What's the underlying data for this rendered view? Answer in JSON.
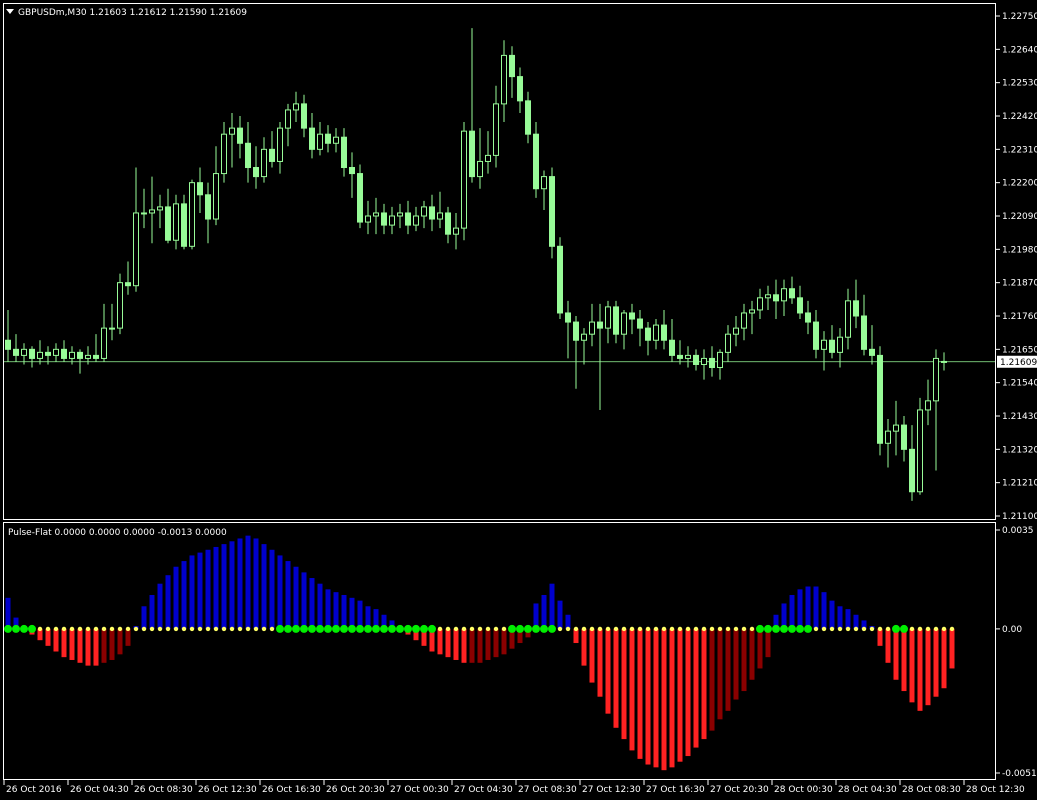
{
  "header": {
    "symbol_line": "GBPUSDm,M30  1.21603 1.21612 1.21590 1.21609"
  },
  "indicator_header": "Pulse-Flat 0.0000 0.0000 0.0000 -0.0013 0.0000",
  "colors": {
    "background": "#000000",
    "frame": "#ffffff",
    "candle": "#98fb98",
    "candle_bull_body": "#000000",
    "candle_bear_body": "#98fb98",
    "bid_line": "#98fb98",
    "hist_up": "#0000cd",
    "hist_down_bright": "#ff2222",
    "hist_down_dark": "#8b0000",
    "dot_yellow": "#ffff66",
    "dot_green": "#00ee00"
  },
  "price_axis": {
    "ticks": [
      "1.22750",
      "1.22640",
      "1.22530",
      "1.22420",
      "1.22310",
      "1.22200",
      "1.22090",
      "1.21980",
      "1.21870",
      "1.21760",
      "1.21650",
      "1.21540",
      "1.21430",
      "1.21320",
      "1.21210",
      "1.21100"
    ],
    "current_label": "1.21609",
    "current_value": 1.21609,
    "range": [
      1.211,
      1.2275
    ]
  },
  "indicator_axis": {
    "ticks": [
      "0.0035",
      "0.00",
      "-0.0051"
    ],
    "range": [
      -0.0051,
      0.0035
    ]
  },
  "time_axis": {
    "labels": [
      "26 Oct 2016",
      "26 Oct 04:30",
      "26 Oct 08:30",
      "26 Oct 12:30",
      "26 Oct 16:30",
      "26 Oct 20:30",
      "27 Oct 00:30",
      "27 Oct 04:30",
      "27 Oct 08:30",
      "27 Oct 12:30",
      "27 Oct 16:30",
      "27 Oct 20:30",
      "28 Oct 00:30",
      "28 Oct 04:30",
      "28 Oct 08:30",
      "28 Oct 12:30"
    ],
    "label_bar_index": [
      0,
      8,
      16,
      24,
      32,
      40,
      48,
      56,
      64,
      72,
      80,
      88,
      96,
      104,
      112,
      120
    ]
  },
  "chart_data": [
    {
      "type": "candlestick",
      "series_ohlc": [
        [
          1.2168,
          1.2178,
          1.2161,
          1.2165
        ],
        [
          1.2165,
          1.217,
          1.2161,
          1.2163
        ],
        [
          1.2163,
          1.2167,
          1.216,
          1.2165
        ],
        [
          1.2165,
          1.2166,
          1.2159,
          1.2162
        ],
        [
          1.2162,
          1.2168,
          1.216,
          1.2164
        ],
        [
          1.2164,
          1.2166,
          1.216,
          1.2163
        ],
        [
          1.2163,
          1.2167,
          1.2161,
          1.2165
        ],
        [
          1.2165,
          1.2168,
          1.2161,
          1.2162
        ],
        [
          1.2162,
          1.2166,
          1.216,
          1.2164
        ],
        [
          1.2164,
          1.2165,
          1.2157,
          1.2162
        ],
        [
          1.2162,
          1.2166,
          1.216,
          1.2163
        ],
        [
          1.2163,
          1.217,
          1.2161,
          1.2162
        ],
        [
          1.2162,
          1.218,
          1.2161,
          1.2172
        ],
        [
          1.2172,
          1.218,
          1.2168,
          1.2172
        ],
        [
          1.2172,
          1.219,
          1.217,
          1.2187
        ],
        [
          1.2187,
          1.2194,
          1.2183,
          1.2186
        ],
        [
          1.2186,
          1.2225,
          1.2184,
          1.221
        ],
        [
          1.221,
          1.2218,
          1.2205,
          1.221
        ],
        [
          1.221,
          1.2222,
          1.22,
          1.2211
        ],
        [
          1.2211,
          1.2216,
          1.2205,
          1.2212
        ],
        [
          1.2212,
          1.2218,
          1.22,
          1.2201
        ],
        [
          1.2201,
          1.2216,
          1.2198,
          1.2213
        ],
        [
          1.2213,
          1.2216,
          1.2198,
          1.2199
        ],
        [
          1.2199,
          1.2221,
          1.2198,
          1.222
        ],
        [
          1.222,
          1.2225,
          1.221,
          1.2216
        ],
        [
          1.2216,
          1.222,
          1.22,
          1.2208
        ],
        [
          1.2208,
          1.2232,
          1.2206,
          1.2223
        ],
        [
          1.2223,
          1.224,
          1.222,
          1.2236
        ],
        [
          1.2236,
          1.2243,
          1.2225,
          1.2238
        ],
        [
          1.2238,
          1.2242,
          1.2228,
          1.2233
        ],
        [
          1.2233,
          1.224,
          1.222,
          1.2225
        ],
        [
          1.2225,
          1.2232,
          1.2218,
          1.2222
        ],
        [
          1.2222,
          1.2235,
          1.222,
          1.2231
        ],
        [
          1.2231,
          1.2237,
          1.2225,
          1.2227
        ],
        [
          1.2227,
          1.224,
          1.2223,
          1.2238
        ],
        [
          1.2238,
          1.2246,
          1.2232,
          1.2244
        ],
        [
          1.2244,
          1.225,
          1.224,
          1.2246
        ],
        [
          1.2246,
          1.2249,
          1.2235,
          1.2238
        ],
        [
          1.2238,
          1.2243,
          1.2228,
          1.2231
        ],
        [
          1.2231,
          1.224,
          1.2229,
          1.2236
        ],
        [
          1.2236,
          1.2239,
          1.223,
          1.2233
        ],
        [
          1.2233,
          1.2238,
          1.223,
          1.2235
        ],
        [
          1.2235,
          1.2238,
          1.2222,
          1.2225
        ],
        [
          1.2225,
          1.223,
          1.2215,
          1.2223
        ],
        [
          1.2223,
          1.2226,
          1.2205,
          1.2207
        ],
        [
          1.2207,
          1.2214,
          1.2203,
          1.2209
        ],
        [
          1.2209,
          1.2215,
          1.2203,
          1.221
        ],
        [
          1.221,
          1.2213,
          1.2203,
          1.2206
        ],
        [
          1.2206,
          1.2212,
          1.2203,
          1.2209
        ],
        [
          1.2209,
          1.2213,
          1.2205,
          1.221
        ],
        [
          1.221,
          1.2214,
          1.2203,
          1.2206
        ],
        [
          1.2206,
          1.2212,
          1.2204,
          1.2209
        ],
        [
          1.2209,
          1.2214,
          1.2205,
          1.2212
        ],
        [
          1.2212,
          1.2216,
          1.2204,
          1.2208
        ],
        [
          1.2208,
          1.2217,
          1.2205,
          1.221
        ],
        [
          1.221,
          1.2212,
          1.22,
          1.2203
        ],
        [
          1.2203,
          1.221,
          1.2198,
          1.2205
        ],
        [
          1.2205,
          1.224,
          1.2201,
          1.2237
        ],
        [
          1.2237,
          1.2271,
          1.222,
          1.2222
        ],
        [
          1.2222,
          1.2238,
          1.2218,
          1.2227
        ],
        [
          1.2227,
          1.2237,
          1.2223,
          1.2229
        ],
        [
          1.2229,
          1.2252,
          1.2225,
          1.2246
        ],
        [
          1.2246,
          1.2267,
          1.224,
          1.2262
        ],
        [
          1.2262,
          1.2265,
          1.2248,
          1.2255
        ],
        [
          1.2255,
          1.2258,
          1.2243,
          1.2247
        ],
        [
          1.2247,
          1.225,
          1.2233,
          1.2236
        ],
        [
          1.2236,
          1.224,
          1.2215,
          1.2218
        ],
        [
          1.2218,
          1.2224,
          1.2211,
          1.2222
        ],
        [
          1.2222,
          1.2225,
          1.2195,
          1.2199
        ],
        [
          1.2199,
          1.2202,
          1.2175,
          1.2177
        ],
        [
          1.2177,
          1.2181,
          1.2162,
          1.2174
        ],
        [
          1.2174,
          1.2176,
          1.2152,
          1.2168
        ],
        [
          1.2168,
          1.2172,
          1.216,
          1.217
        ],
        [
          1.217,
          1.218,
          1.2166,
          1.2174
        ],
        [
          1.2174,
          1.218,
          1.2145,
          1.2172
        ],
        [
          1.2172,
          1.2181,
          1.2167,
          1.2179
        ],
        [
          1.2179,
          1.2181,
          1.2167,
          1.217
        ],
        [
          1.217,
          1.2178,
          1.2165,
          1.2177
        ],
        [
          1.2177,
          1.218,
          1.217,
          1.2175
        ],
        [
          1.2175,
          1.2178,
          1.2166,
          1.2172
        ],
        [
          1.2172,
          1.2174,
          1.2163,
          1.2168
        ],
        [
          1.2168,
          1.2175,
          1.2165,
          1.2173
        ],
        [
          1.2173,
          1.2178,
          1.2165,
          1.2168
        ],
        [
          1.2168,
          1.2175,
          1.2161,
          1.2163
        ],
        [
          1.2163,
          1.2168,
          1.216,
          1.2162
        ],
        [
          1.2162,
          1.2166,
          1.2159,
          1.2163
        ],
        [
          1.2163,
          1.2165,
          1.2158,
          1.216
        ],
        [
          1.216,
          1.2165,
          1.2155,
          1.2162
        ],
        [
          1.2162,
          1.2166,
          1.2156,
          1.2159
        ],
        [
          1.2159,
          1.2165,
          1.2155,
          1.2164
        ],
        [
          1.2164,
          1.2173,
          1.2161,
          1.217
        ],
        [
          1.217,
          1.2176,
          1.2166,
          1.2172
        ],
        [
          1.2172,
          1.218,
          1.2168,
          1.2177
        ],
        [
          1.2177,
          1.2181,
          1.217,
          1.2178
        ],
        [
          1.2178,
          1.2185,
          1.2175,
          1.2182
        ],
        [
          1.2182,
          1.2186,
          1.2178,
          1.2183
        ],
        [
          1.2183,
          1.2188,
          1.2175,
          1.2181
        ],
        [
          1.2181,
          1.2188,
          1.2176,
          1.2185
        ],
        [
          1.2185,
          1.2189,
          1.218,
          1.2182
        ],
        [
          1.2182,
          1.2186,
          1.2175,
          1.2177
        ],
        [
          1.2177,
          1.2181,
          1.217,
          1.2174
        ],
        [
          1.2174,
          1.2178,
          1.2162,
          1.2165
        ],
        [
          1.2165,
          1.2171,
          1.2158,
          1.2168
        ],
        [
          1.2168,
          1.2173,
          1.2162,
          1.2164
        ],
        [
          1.2164,
          1.2172,
          1.2159,
          1.2169
        ],
        [
          1.2169,
          1.2185,
          1.2165,
          1.2181
        ],
        [
          1.2181,
          1.2188,
          1.2172,
          1.2176
        ],
        [
          1.2176,
          1.2183,
          1.2163,
          1.2165
        ],
        [
          1.2165,
          1.2173,
          1.216,
          1.2163
        ],
        [
          1.2163,
          1.2166,
          1.213,
          1.2134
        ],
        [
          1.2134,
          1.2142,
          1.2126,
          1.2138
        ],
        [
          1.2138,
          1.2148,
          1.213,
          1.214
        ],
        [
          1.214,
          1.2143,
          1.2128,
          1.2132
        ],
        [
          1.2132,
          1.214,
          1.2115,
          1.2118
        ],
        [
          1.2118,
          1.2149,
          1.2117,
          1.2145
        ],
        [
          1.2145,
          1.2155,
          1.214,
          1.2148
        ],
        [
          1.2148,
          1.2165,
          1.2125,
          1.2162
        ],
        [
          1.2161,
          1.2164,
          1.2158,
          1.2161
        ]
      ]
    },
    {
      "type": "bar",
      "title": "Pulse-Flat",
      "values": [
        0.0011,
        0.0004,
        -0.0001,
        -0.0002,
        -0.0004,
        -0.0006,
        -0.0008,
        -0.001,
        -0.0011,
        -0.0012,
        -0.0013,
        -0.0013,
        -0.0012,
        -0.0011,
        -0.0009,
        -0.0006,
        0.0001,
        0.0008,
        0.0012,
        0.0016,
        0.0019,
        0.0022,
        0.0024,
        0.0026,
        0.0027,
        0.0028,
        0.0029,
        0.003,
        0.0031,
        0.0032,
        0.0033,
        0.0032,
        0.003,
        0.0028,
        0.0026,
        0.0024,
        0.0022,
        0.002,
        0.0018,
        0.0016,
        0.0014,
        0.0013,
        0.0012,
        0.0011,
        0.001,
        0.0008,
        0.0007,
        0.0005,
        0.0003,
        0.0001,
        -0.0002,
        -0.0004,
        -0.0006,
        -0.0008,
        -0.0009,
        -0.001,
        -0.0011,
        -0.0012,
        -0.0012,
        -0.0012,
        -0.0011,
        -0.001,
        -0.0009,
        -0.0007,
        -0.0005,
        -0.0003,
        0.0009,
        0.0012,
        0.0016,
        0.001,
        0.0005,
        -0.0005,
        -0.0013,
        -0.0019,
        -0.0024,
        -0.003,
        -0.0035,
        -0.0039,
        -0.0043,
        -0.0046,
        -0.0048,
        -0.0049,
        -0.005,
        -0.0049,
        -0.0047,
        -0.0045,
        -0.0042,
        -0.0039,
        -0.0036,
        -0.0032,
        -0.0029,
        -0.0025,
        -0.0022,
        -0.0018,
        -0.0014,
        -0.001,
        0.0005,
        0.0009,
        0.0012,
        0.0014,
        0.0015,
        0.0015,
        0.0013,
        0.001,
        0.0008,
        0.0007,
        0.0005,
        0.0003,
        0.0001,
        -0.0006,
        -0.0012,
        -0.0018,
        -0.0022,
        -0.0026,
        -0.0029,
        -0.0027,
        -0.0024,
        -0.0021,
        -0.0014
      ],
      "down_dark_from_index": [
        12,
        58,
        88,
        119
      ],
      "green_dot_indices": [
        0,
        1,
        2,
        3,
        34,
        35,
        36,
        37,
        38,
        39,
        40,
        41,
        42,
        43,
        44,
        45,
        46,
        47,
        48,
        49,
        50,
        51,
        52,
        53,
        63,
        64,
        65,
        66,
        67,
        68,
        94,
        95,
        96,
        97,
        98,
        99,
        100,
        111,
        112
      ]
    }
  ]
}
